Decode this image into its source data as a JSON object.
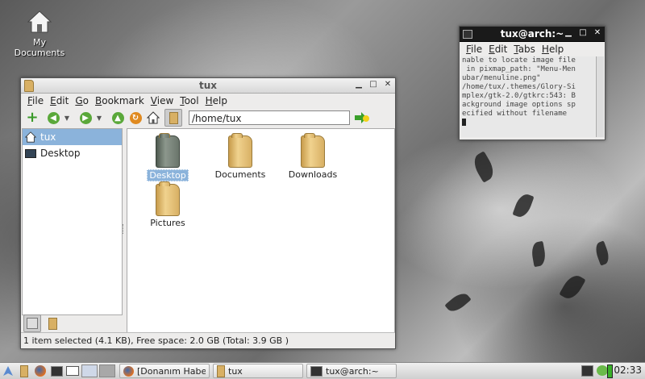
{
  "desktop": {
    "icon_label": "My Documents"
  },
  "fm": {
    "title": "tux",
    "menu": [
      "File",
      "Edit",
      "Go",
      "Bookmark",
      "View",
      "Tool",
      "Help"
    ],
    "path": "/home/tux",
    "sidebar": [
      {
        "label": "tux",
        "selected": true,
        "icon": "home-icon"
      },
      {
        "label": "Desktop",
        "selected": false,
        "icon": "desktop-icon"
      }
    ],
    "files": [
      {
        "name": "Desktop",
        "selected": true
      },
      {
        "name": "Documents",
        "selected": false
      },
      {
        "name": "Downloads",
        "selected": false
      },
      {
        "name": "Pictures",
        "selected": false
      }
    ],
    "status": "1 item selected (4.1 KB), Free space: 2.0 GB (Total: 3.9 GB )"
  },
  "terminal": {
    "title": "tux@arch:~",
    "menu": [
      "File",
      "Edit",
      "Tabs",
      "Help"
    ],
    "lines": [
      "nable to locate image file",
      " in pixmap_path: \"Menu-Men",
      "ubar/menuline.png\"",
      "/home/tux/.themes/Glory-Si",
      "mplex/gtk-2.0/gtkrc:543: B",
      "ackground image options sp",
      "ecified without filename"
    ]
  },
  "taskbar": {
    "tasks": [
      {
        "label": "[Donanım Habe...",
        "icon": "firefox-icon"
      },
      {
        "label": "tux",
        "icon": "folder-icon"
      },
      {
        "label": "tux@arch:~",
        "icon": "terminal-icon"
      }
    ],
    "clock": "02:33"
  },
  "colors": {
    "selection": "#8bb3db",
    "folder": "#e0b96a"
  }
}
